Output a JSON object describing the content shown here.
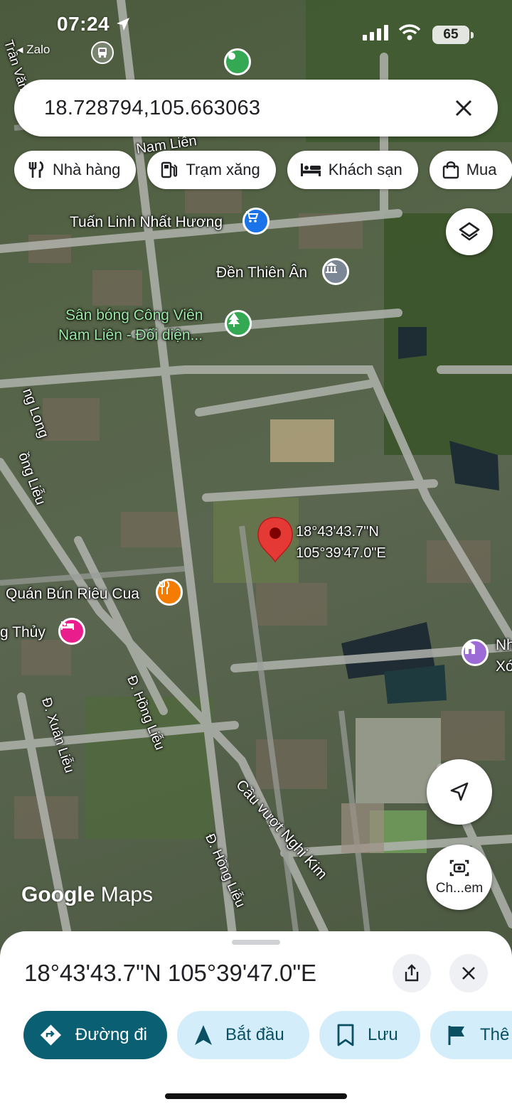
{
  "status_bar": {
    "time": "07:24",
    "back_app": "Zalo",
    "battery": "65"
  },
  "search": {
    "query": "18.728794,105.663063"
  },
  "chips": [
    {
      "label": "Nhà hàng",
      "icon": "restaurant-icon"
    },
    {
      "label": "Trạm xăng",
      "icon": "gas-station-icon"
    },
    {
      "label": "Khách sạn",
      "icon": "hotel-icon"
    },
    {
      "label": "Mua",
      "icon": "shopping-bag-icon"
    }
  ],
  "map": {
    "places": {
      "shop": "Tuấn Linh Nhất Hương",
      "temple": "Đền Thiên Ân",
      "park_line1": "Sân bóng Công Viên",
      "park_line2": "Nam Liên - Đối diện...",
      "restaurant": "Quán Bún Riêu Cua",
      "hotel_partial": "g Thủy",
      "right_partial_1": "Nh",
      "right_partial_2": "Xó",
      "pin_lat": "18°43'43.7\"N",
      "pin_lng": "105°39'47.0\"E"
    },
    "streets": {
      "nam_lien": "Nam Liên",
      "tran_van": "Trần Văn",
      "long": "ng Long",
      "hong_lieu_left": "ồng Liễu",
      "xuan_lieu": "Đ. Xuân Liễu",
      "hong_lieu_1": "Đ. Hồng Liễu",
      "hong_lieu_2": "Đ. Hồng Liễu",
      "cau_vuot": "Cầu vượt Nghi Kim"
    },
    "logo": {
      "google": "Google",
      "maps": "Maps"
    },
    "camera_button_label": "Ch...em"
  },
  "sheet": {
    "title": "18°43'43.7\"N 105°39'47.0\"E",
    "actions": [
      {
        "label": "Đường đi",
        "icon": "directions-icon"
      },
      {
        "label": "Bắt đầu",
        "icon": "navigation-arrow-icon"
      },
      {
        "label": "Lưu",
        "icon": "bookmark-icon"
      },
      {
        "label": "Thê",
        "icon": "flag-icon"
      }
    ]
  },
  "colors": {
    "primary_action": "#0b5f73",
    "secondary_action": "#d3eefa",
    "pin": "#e53935",
    "park_poi": "#34a853",
    "shop_poi": "#1a73e8",
    "food_poi": "#f57c00",
    "hotel_poi": "#e91e8c",
    "temple_poi": "#9c6bd6"
  }
}
